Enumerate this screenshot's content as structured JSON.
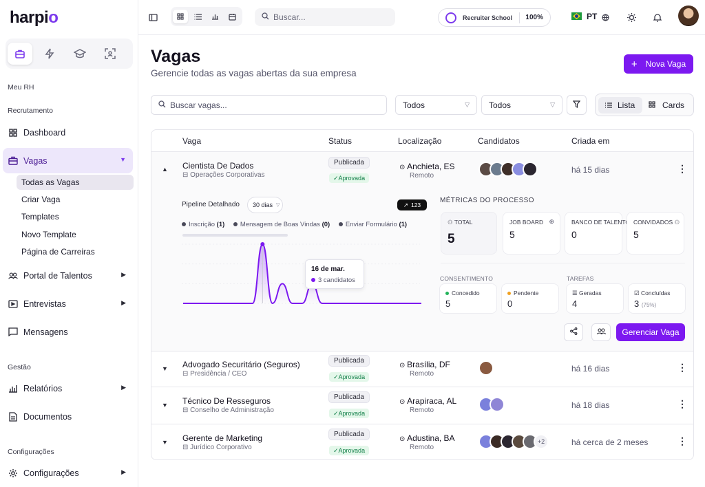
{
  "app": {
    "logo_text": "harpio"
  },
  "sidebar": {
    "section_meu_rh": "Meu RH",
    "section_recrutamento": "Recrutamento",
    "dashboard": "Dashboard",
    "vagas": "Vagas",
    "vagas_sub": [
      "Todas as Vagas",
      "Criar Vaga",
      "Templates",
      "Novo Template",
      "Página de Carreiras"
    ],
    "portal": "Portal de Talentos",
    "entrevistas": "Entrevistas",
    "mensagens": "Mensagens",
    "section_gestao": "Gestão",
    "relatorios": "Relatórios",
    "documentos": "Documentos",
    "section_config": "Configurações",
    "configuracoes": "Configurações"
  },
  "topbar": {
    "search_placeholder": "Buscar...",
    "school_name": "Recruiter School",
    "school_pct": "100%",
    "lang": "PT"
  },
  "page": {
    "title": "Vagas",
    "subtitle": "Gerencie todas as vagas abertas da sua empresa",
    "new_button": "Nova Vaga"
  },
  "filters": {
    "search_placeholder": "Buscar vagas...",
    "status_select": "Todos",
    "location_select": "Todos",
    "view_list": "Lista",
    "view_cards": "Cards"
  },
  "table": {
    "headers": [
      "Vaga",
      "Status",
      "Localização",
      "Candidatos",
      "Criada em"
    ],
    "rows": [
      {
        "title": "Cientista De Dados",
        "dept": "Operações Corporativas",
        "status": "Publicada",
        "approval": "✓Aprovada",
        "city": "Anchieta, ES",
        "mode": "Remoto",
        "created": "há 15 dias"
      },
      {
        "title": "Advogado Securitário (Seguros)",
        "dept": "Presidência / CEO",
        "status": "Publicada",
        "approval": "✓Aprovada",
        "city": "Brasília, DF",
        "mode": "Remoto",
        "created": "há 16 dias"
      },
      {
        "title": "Técnico De Resseguros",
        "dept": "Conselho de Administração",
        "status": "Publicada",
        "approval": "✓Aprovada",
        "city": "Arapiraca, AL",
        "mode": "Remoto",
        "created": "há 18 dias"
      },
      {
        "title": "Gerente de Marketing",
        "dept": "Jurídico Corporativo",
        "status": "Publicada",
        "approval": "✓Aprovada",
        "city": "Adustina, BA",
        "mode": "Remoto",
        "created": "há cerca de 2 meses",
        "extra": "+2"
      }
    ]
  },
  "detail": {
    "pipeline_label": "Pipeline Detalhado",
    "range": "30 dias",
    "total_badge": "123",
    "legend": [
      {
        "label": "Inscrição",
        "count": "(1)"
      },
      {
        "label": "Mensagem de Boas Vindas",
        "count": "(0)"
      },
      {
        "label": "Enviar Formulário",
        "count": "(1)"
      }
    ],
    "tooltip_date": "16 de mar.",
    "tooltip_value": "3 candidatos",
    "metrics_title": "MÉTRICAS DO PROCESSO",
    "metrics": [
      {
        "label": "TOTAL",
        "value": "5"
      },
      {
        "label": "JOB BOARD",
        "value": "5"
      },
      {
        "label": "BANCO DE TALENTO",
        "value": "0"
      },
      {
        "label": "CONVIDADOS",
        "value": "5"
      }
    ],
    "consent_title": "CONSENTIMENTO",
    "consent": [
      {
        "label": "Concedido",
        "value": "5"
      },
      {
        "label": "Pendente",
        "value": "0"
      }
    ],
    "tasks_title": "TAREFAS",
    "tasks": [
      {
        "label": "Geradas",
        "value": "4"
      },
      {
        "label": "Concluídas",
        "value": "3",
        "pct": "(75%)"
      }
    ],
    "manage_button": "Gerenciar Vaga"
  },
  "chart_data": {
    "type": "line",
    "points": [
      0,
      0,
      0,
      0,
      0,
      0,
      0,
      0,
      3,
      0,
      1,
      0,
      0,
      1,
      0,
      0,
      0,
      0,
      0,
      0,
      0,
      0,
      0,
      0,
      0
    ],
    "highlight_index": 8
  },
  "colors": {
    "accent": "#7c19f0",
    "approved_bg": "#e4f7ea",
    "approved_fg": "#14804a"
  }
}
